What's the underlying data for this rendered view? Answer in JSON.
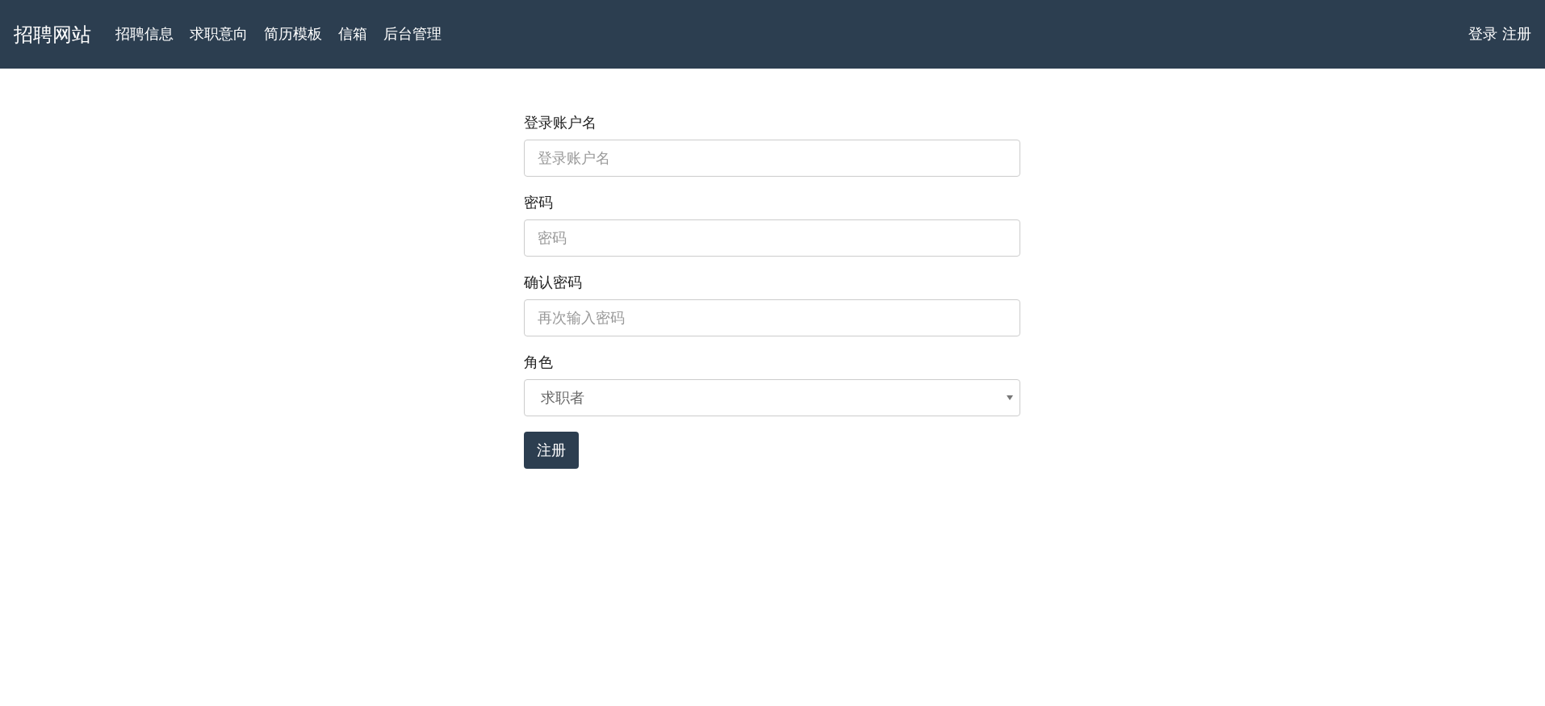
{
  "navbar": {
    "brand": "招聘网站",
    "links": [
      "招聘信息",
      "求职意向",
      "简历模板",
      "信箱",
      "后台管理"
    ],
    "auth_links": [
      "登录",
      "注册"
    ]
  },
  "form": {
    "fields": [
      {
        "kind": "input",
        "label": "登录账户名",
        "placeholder": "登录账户名"
      },
      {
        "kind": "input",
        "label": "密码",
        "placeholder": "密码"
      },
      {
        "kind": "input",
        "label": "确认密码",
        "placeholder": "再次输入密码"
      },
      {
        "kind": "select",
        "label": "角色",
        "value": "求职者"
      }
    ],
    "submit": "注册"
  }
}
